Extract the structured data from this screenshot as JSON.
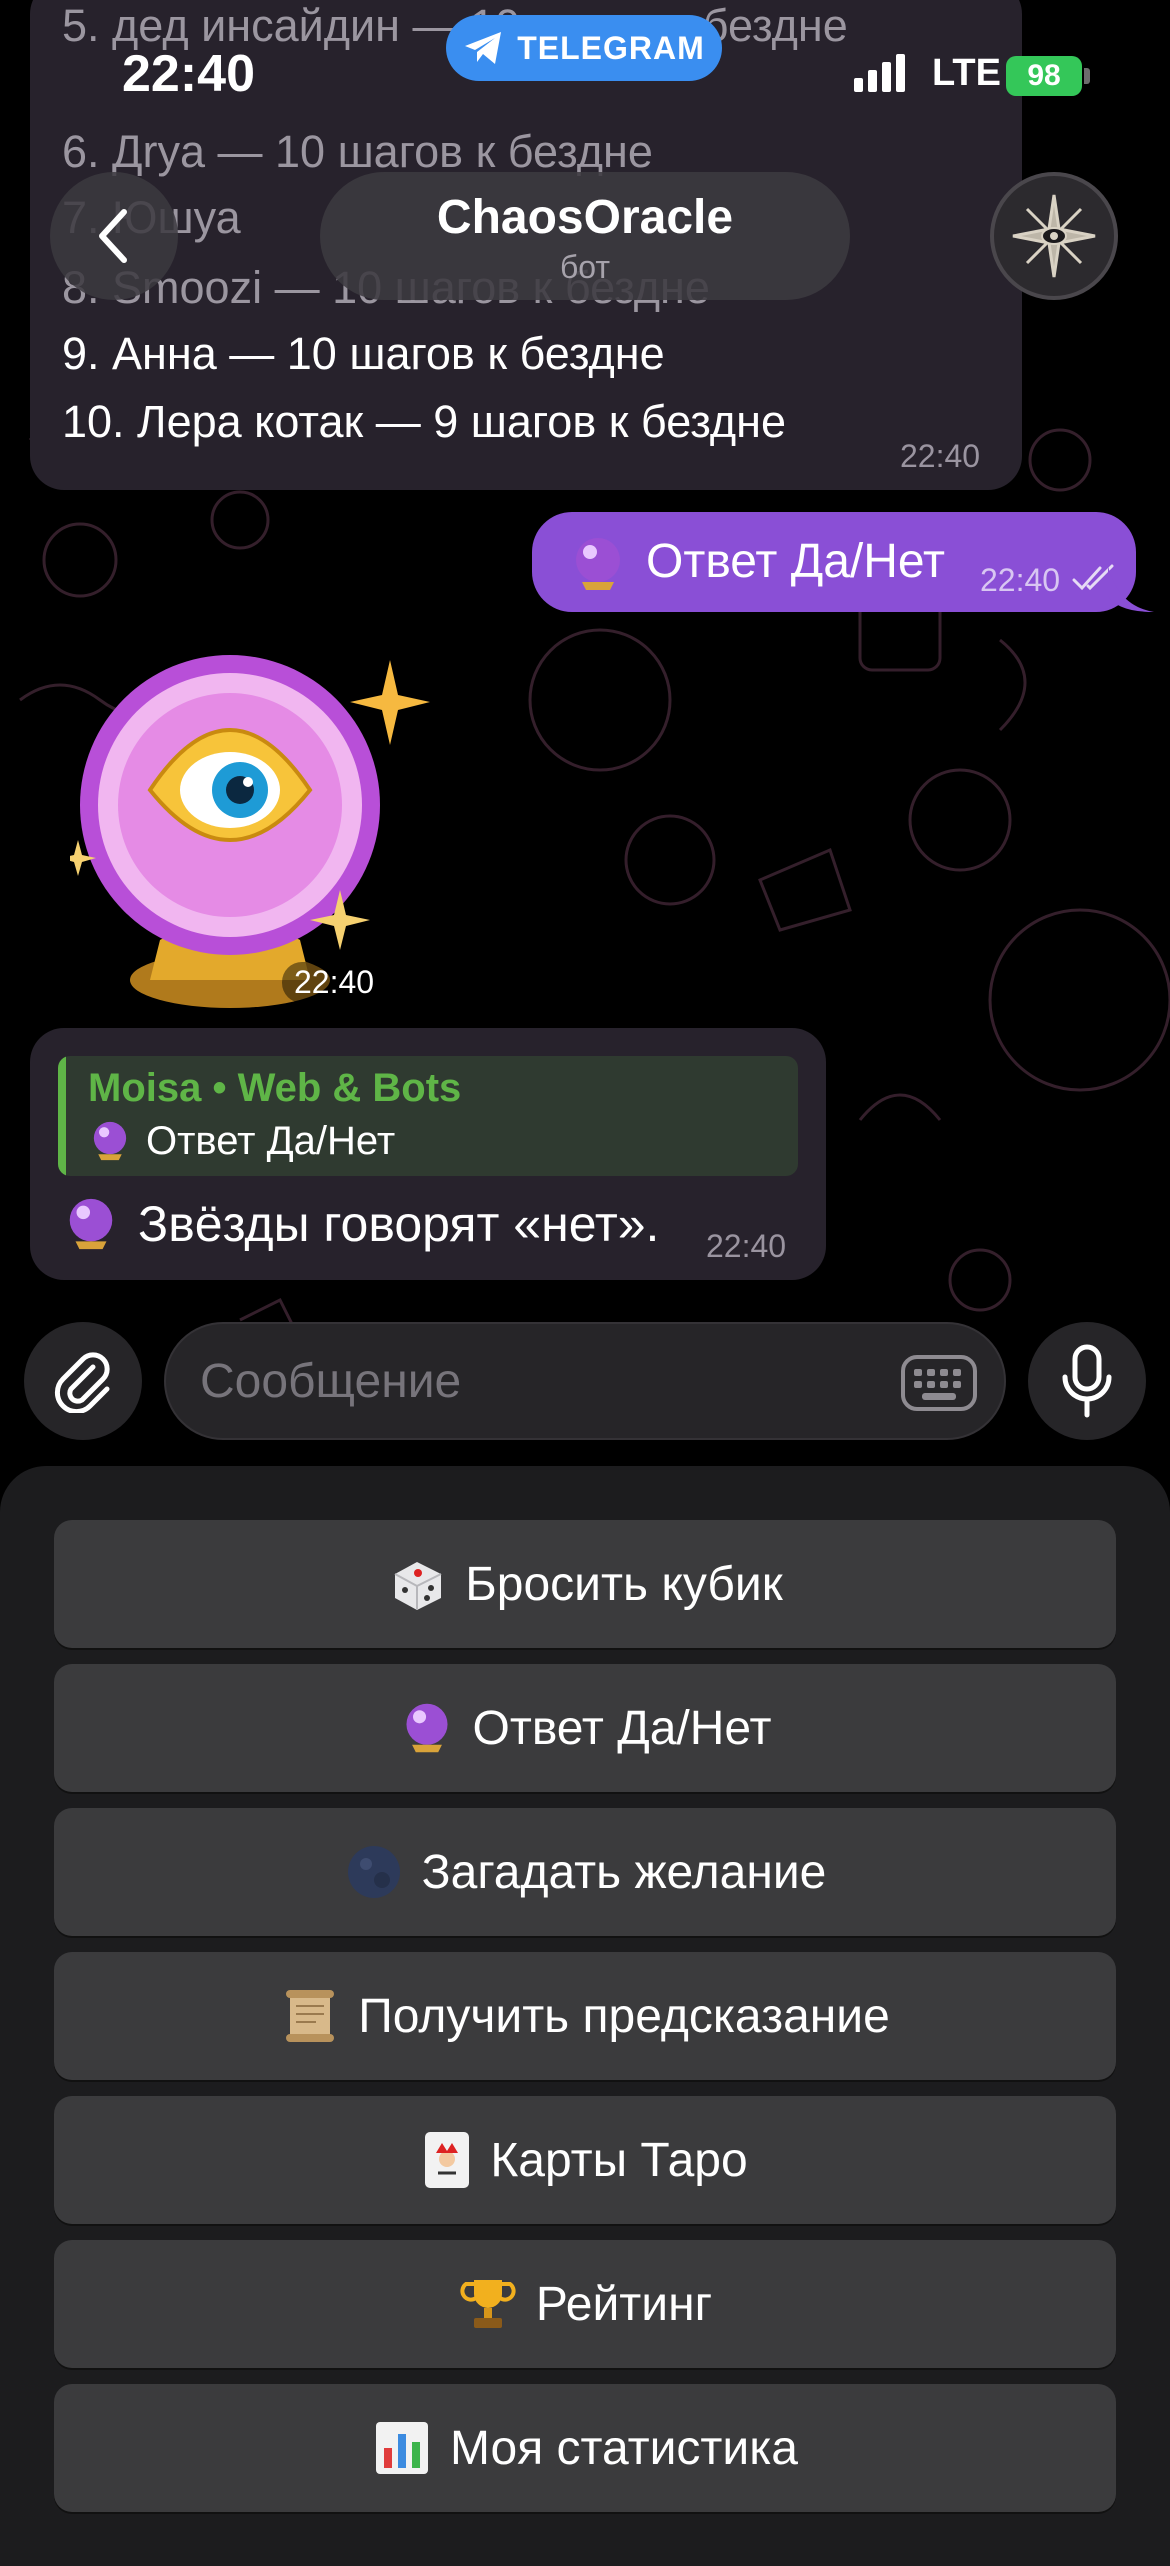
{
  "status_bar": {
    "time": "22:40",
    "app_pill": "TELEGRAM",
    "network": "LTE",
    "battery": "98"
  },
  "header": {
    "title": "ChaosOracle",
    "subtitle": "бот"
  },
  "messages": {
    "top_bubble": {
      "lines": [
        "5. дед инсайдин — 10 шагов к бездне",
        "6. Дrya — 10 шагов к бездне",
        "7. Юшуа",
        "8. Smoozi — 10 шагов к бездне",
        "9. Анна — 10 шагов к бездне",
        "10. Лера котак — 9 шагов к бездне"
      ],
      "time": "22:40"
    },
    "outgoing": {
      "text": "Ответ Да/Нет",
      "time": "22:40"
    },
    "sticker_time": "22:40",
    "incoming": {
      "reply_name": "Moisa • Web & Bots",
      "reply_text": "Ответ Да/Нет",
      "text": "Звёзды говорят «нет».",
      "time": "22:40"
    }
  },
  "composer": {
    "placeholder": "Сообщение"
  },
  "keyboard": {
    "buttons": [
      {
        "icon": "dice-icon",
        "label": "Бросить кубик"
      },
      {
        "icon": "crystal-ball-icon",
        "label": "Ответ Да/Нет"
      },
      {
        "icon": "moon-icon",
        "label": "Загадать желание"
      },
      {
        "icon": "scroll-icon",
        "label": "Получить предсказание"
      },
      {
        "icon": "joker-card-icon",
        "label": "Карты Таро"
      },
      {
        "icon": "trophy-icon",
        "label": "Рейтинг"
      },
      {
        "icon": "bar-chart-icon",
        "label": "Моя статистика"
      }
    ]
  },
  "colors": {
    "outgoing_bubble": "#8a4fd6",
    "incoming_bubble": "#27222c",
    "reply_accent": "#5fb547",
    "telegram_pill": "#3a8ef0",
    "battery": "#34c759"
  }
}
